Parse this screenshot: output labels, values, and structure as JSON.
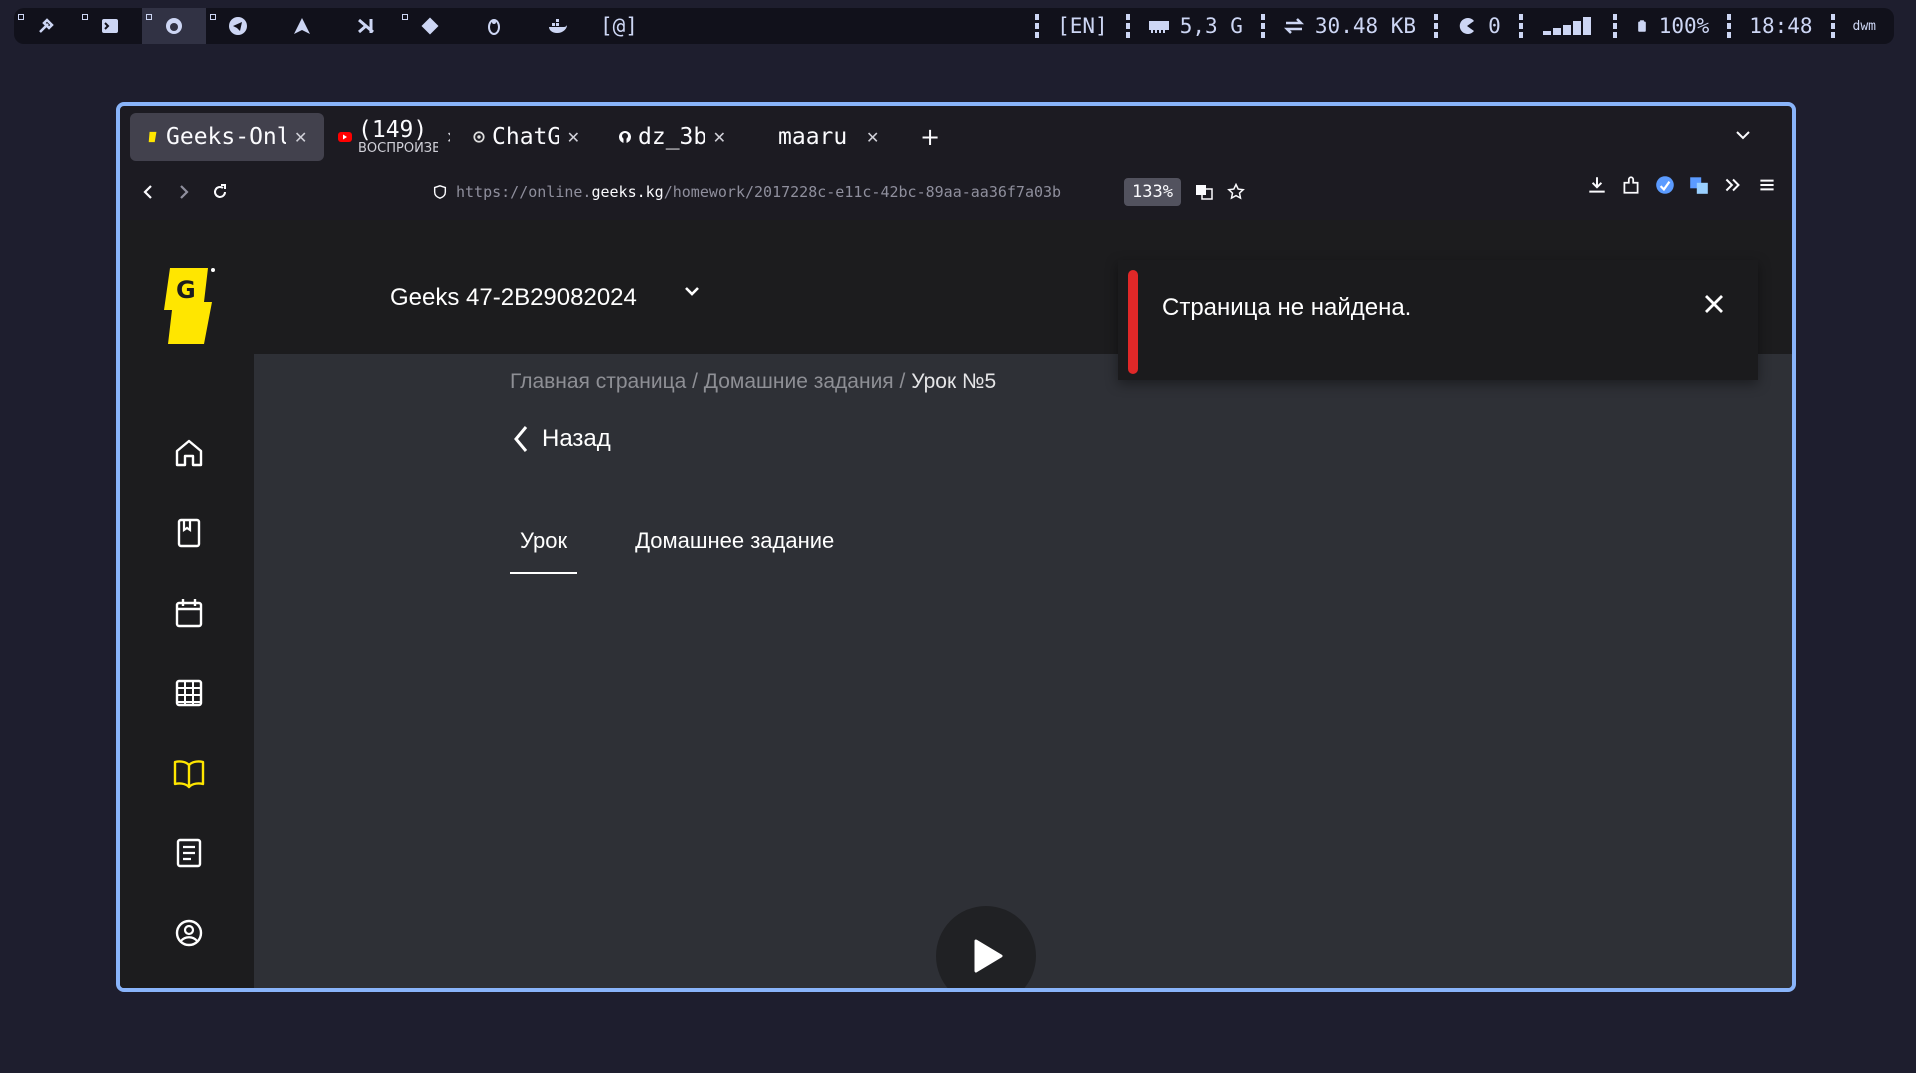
{
  "statusbar": {
    "workspace_tag": "[@]",
    "keyboard_layout": "[EN]",
    "memory": "5,3 G",
    "network": "30.48 KB",
    "updates": "0",
    "battery": "100%",
    "clock": "18:48",
    "wm_label": "dwm"
  },
  "browser": {
    "tabs": [
      {
        "title": "Geeks-Online",
        "active": true
      },
      {
        "title": "(149)",
        "subtitle": "ВОСПРОИЗВЕДЕНИЕ"
      },
      {
        "title": "ChatGPT"
      },
      {
        "title": "dz_3b"
      },
      {
        "title": "maaru"
      }
    ],
    "url_prefix": "https://online.",
    "url_domain": "geeks.kg",
    "url_path": "/homework/2017228c-e11c-42bc-89aa-aa36f7a03b",
    "zoom": "133%",
    "new_tab": "+"
  },
  "page": {
    "group_name": "Geeks 47-2B29082024",
    "breadcrumb": {
      "home": "Главная страница",
      "sep1": " / ",
      "homeworks": "Домашние задания",
      "sep2": " / ",
      "current": "Урок №5"
    },
    "back_label": "Назад",
    "tabs": {
      "lesson": "Урок",
      "homework": "Домашнее задание"
    },
    "toast": {
      "message": "Страница не найдена.",
      "accent": "#e02828"
    },
    "brand_color": "#ffe600"
  }
}
